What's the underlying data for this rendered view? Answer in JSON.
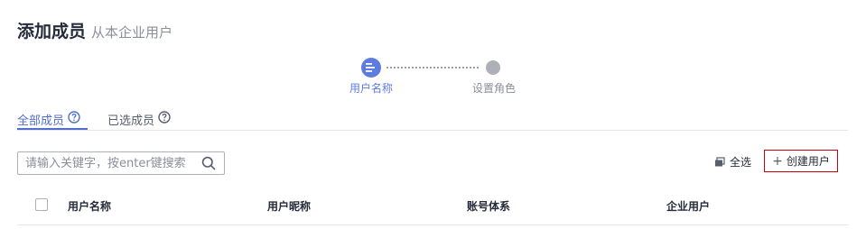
{
  "header": {
    "title": "添加成员",
    "subtitle": "从本企业用户"
  },
  "steps": [
    {
      "label": "用户名称",
      "state": "active",
      "icon": "list-icon"
    },
    {
      "label": "设置角色",
      "state": "pending",
      "icon": "dot-icon"
    }
  ],
  "tabs": [
    {
      "label": "全部成员",
      "active": true,
      "icon": "help-circle-icon"
    },
    {
      "label": "已选成员",
      "active": false,
      "icon": "help-circle-icon"
    }
  ],
  "search": {
    "placeholder": "请输入关键字，按enter键搜索",
    "value": "",
    "icon": "search-icon"
  },
  "toolbar": {
    "select_all_label": "全选",
    "select_all_icon": "stack-icon",
    "create_label": "创建用户",
    "create_icon": "plus-icon"
  },
  "table": {
    "columns": [
      "用户名称",
      "用户昵称",
      "账号体系",
      "企业用户"
    ]
  },
  "colors": {
    "accent": "#5e7ce0",
    "tab_active": "#526ecc",
    "step_idle": "#adb0b8",
    "create_border": "#c7000b",
    "text_primary": "#252b3a",
    "text_muted": "#8a8e99"
  }
}
